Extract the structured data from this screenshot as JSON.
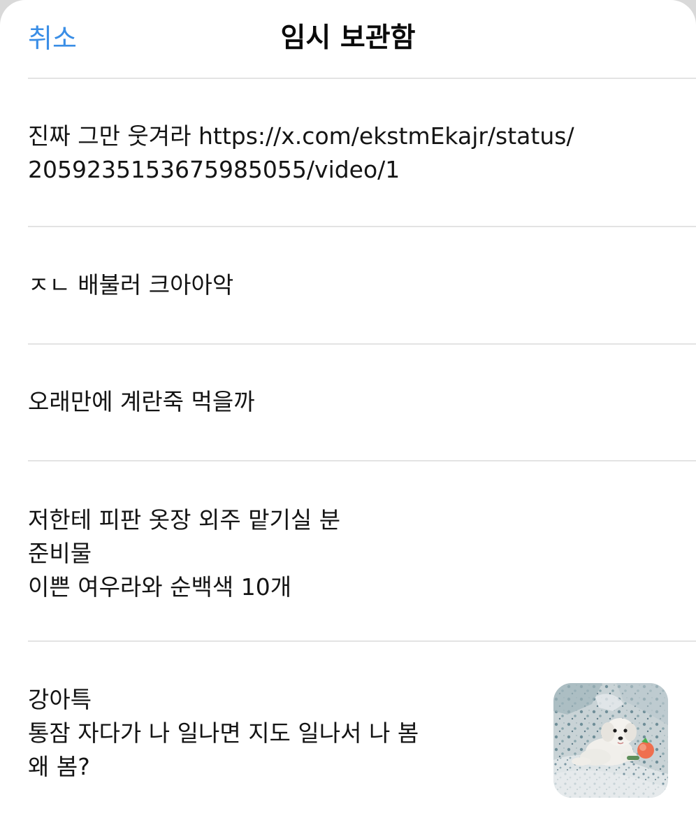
{
  "header": {
    "cancel_label": "취소",
    "title": "임시 보관함"
  },
  "drafts": [
    {
      "text": "진짜 그만 웃겨라 https://x.com/ekstmEkajr/status/\n2059235153675985055/video/1"
    },
    {
      "text": "ㅈㄴ 배불러 크아아악"
    },
    {
      "text": "오래만에 계란죽 먹을까"
    },
    {
      "text": "저한테 피판 옷장 외주 맡기실 분\n준비물\n이쁜 여우라와 순백색 10개"
    },
    {
      "text": "강아특\n통잠 자다가 나 일나면 지도 일나서 나 봄\n왜 봄?",
      "has_image": true,
      "image": "white-dog-photo"
    }
  ],
  "colors": {
    "accent": "#3a8ee6",
    "divider": "#e3e3e3",
    "text": "#141414"
  }
}
